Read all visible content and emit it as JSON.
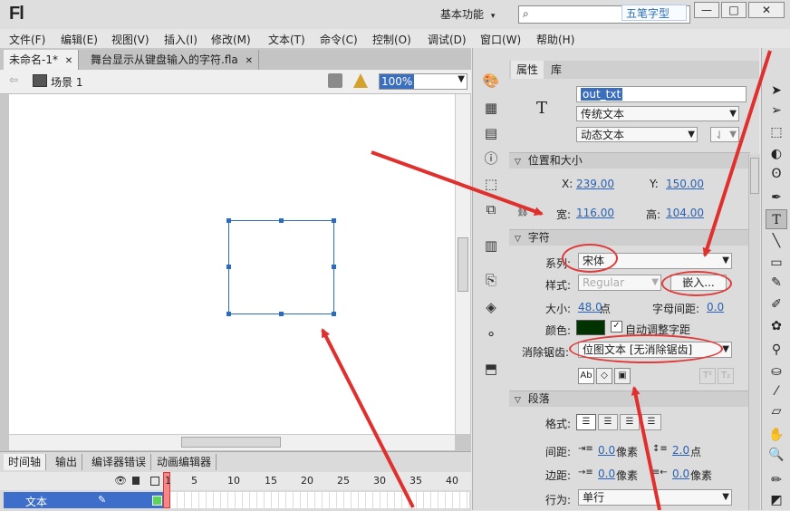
{
  "app": {
    "logo": "Fl",
    "workspace": "基本功能",
    "workspace_arrow": "▾",
    "search_icon": "⌕",
    "search_placeholder": "",
    "badge": "五笔字型"
  },
  "window_controls": {
    "minimize": "—",
    "maximize": "□",
    "close": "✕"
  },
  "menu": [
    "文件(F)",
    "编辑(E)",
    "视图(V)",
    "插入(I)",
    "修改(M)",
    "文本(T)",
    "命令(C)",
    "控制(O)",
    "调试(D)",
    "窗口(W)",
    "帮助(H)"
  ],
  "doc_tabs": [
    {
      "label": "未命名-1*",
      "close": "✕"
    },
    {
      "label": "舞台显示从键盘输入的字符.fla",
      "close": "✕"
    }
  ],
  "scene": {
    "back": "⇦",
    "label": "场景 1",
    "zoom": "100%"
  },
  "timeline": {
    "tabs": [
      "时间轴",
      "输出",
      "编译器错误",
      "动画编辑器"
    ],
    "frame_numbers": [
      "1",
      "5",
      "10",
      "15",
      "20",
      "25",
      "30",
      "35",
      "40"
    ],
    "layer_name": "文本"
  },
  "properties": {
    "tabs": [
      "属性",
      "库"
    ],
    "text_icon": "T",
    "instance_name": "out_txt",
    "text_engine": "传统文本",
    "text_type": "动态文本",
    "position_size": {
      "title": "位置和大小",
      "x_label": "X:",
      "x": "239.00",
      "y_label": "Y:",
      "y": "150.00",
      "w_label": "宽:",
      "w": "116.00",
      "h_label": "高:",
      "h": "104.00"
    },
    "character": {
      "title": "字符",
      "family_label": "系列:",
      "family": "宋体",
      "style_label": "样式:",
      "style": "Regular",
      "embed_button": "嵌入...",
      "size_label": "大小:",
      "size": "48.0",
      "size_unit": "点",
      "spacing_label": "字母间距:",
      "spacing": "0.0",
      "color_label": "颜色:",
      "color": "#003300",
      "autokern_label": "自动调整字距",
      "aa_label": "消除锯齿:",
      "aa": "位图文本 [无消除锯齿]"
    },
    "paragraph": {
      "title": "段落",
      "format_label": "格式:",
      "spacing_label": "间距:",
      "indent": "0.0",
      "indent_unit": "像素",
      "line": "2.0",
      "line_unit": "点",
      "margin_label": "边距:",
      "left_margin": "0.0",
      "left_unit": "像素",
      "right_margin": "0.0",
      "right_unit": "像素",
      "behavior_label": "行为:",
      "behavior": "单行"
    }
  }
}
